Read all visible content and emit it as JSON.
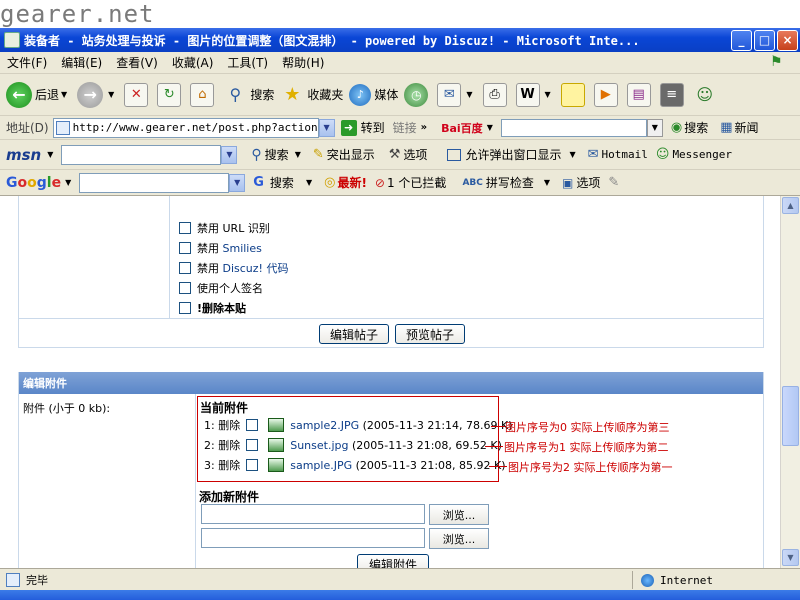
{
  "watermark": "gearer.net",
  "window": {
    "title": "装备者 - 站务处理与投诉 - 图片的位置调整（图文混排） - powered by Discuz! - Microsoft Inte...",
    "minimize": "_",
    "maximize": "□",
    "close": "×"
  },
  "menubar": {
    "items": [
      "文件(F)",
      "编辑(E)",
      "查看(V)",
      "收藏(A)",
      "工具(T)",
      "帮助(H)"
    ]
  },
  "toolbar": {
    "back": "后退",
    "search": "搜索",
    "favorites": "收藏夹",
    "media": "媒体"
  },
  "addressbar": {
    "label": "地址(D)",
    "url": "http://www.gearer.net/post.php?action=",
    "go": "转到",
    "links": "链接",
    "baidu": "Bai百度",
    "baidu_search": "搜索",
    "baidu_news": "新闻"
  },
  "msnbar": {
    "logo": "msn",
    "search": "搜索",
    "highlight": "突出显示",
    "options": "选项",
    "popups": "允许弹出窗口显示",
    "hotmail": "Hotmail",
    "messenger": "Messenger"
  },
  "googlebar": {
    "logo": "Google",
    "search": "搜索",
    "latest": "最新!",
    "blocked": "1 个已拦截",
    "spellcheck": "拼写检查",
    "options": "选项"
  },
  "options": {
    "disable_url": "禁用 URL 识别",
    "disable_smilies_prefix": "禁用",
    "disable_smilies_link": "Smilies",
    "disable_discuz_prefix": "禁用",
    "disable_discuz_link": "Discuz! 代码",
    "use_signature": "使用个人签名",
    "delete_post": "!删除本贴"
  },
  "buttons": {
    "edit_post": "编辑帖子",
    "preview_post": "预览帖子",
    "edit_attachment": "编辑附件"
  },
  "attachments": {
    "header": "编辑附件",
    "label": "附件 (小于 0 kb):",
    "current_title": "当前附件",
    "files": [
      {
        "index": "1:",
        "delete": "删除",
        "name": "sample2.JPG",
        "meta": "(2005-11-3 21:14, 78.69 K)",
        "note": "图片序号为0  实际上传顺序为第三"
      },
      {
        "index": "2:",
        "delete": "删除",
        "name": "Sunset.jpg",
        "meta": "(2005-11-3 21:08, 69.52 K)",
        "note": "图片序号为1  实际上传顺序为第二"
      },
      {
        "index": "3:",
        "delete": "删除",
        "name": "sample.JPG",
        "meta": "(2005-11-3 21:08, 85.92 K)",
        "note": "图片序号为2  实际上传顺序为第一"
      }
    ],
    "new_title": "添加新附件",
    "browse": "浏览..."
  },
  "statusbar": {
    "status": "完毕",
    "zone": "Internet"
  },
  "colors": {
    "titlebar": "#0a46d6",
    "chrome": "#ece9d8",
    "annotation": "#cc0000",
    "link": "#0b3c88",
    "panel_header": "#5a86c8"
  }
}
